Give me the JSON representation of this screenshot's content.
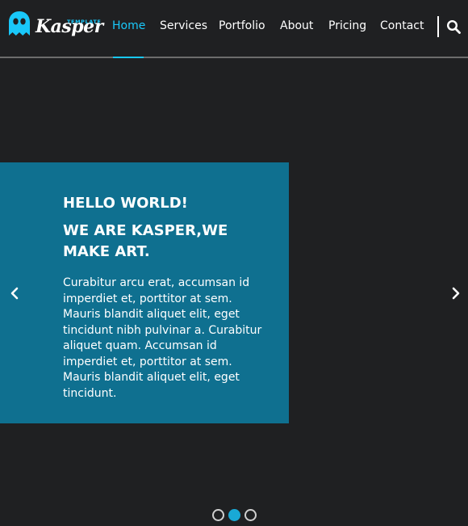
{
  "brand": {
    "name": "Kasper",
    "tag": "TEMPLATE",
    "accent_color": "#19c8fa"
  },
  "nav": {
    "items": [
      {
        "label": "Home",
        "active": true
      },
      {
        "label": "Services",
        "active": false
      },
      {
        "label": "Portfolio",
        "active": false
      },
      {
        "label": "About",
        "active": false
      },
      {
        "label": "Pricing",
        "active": false
      },
      {
        "label": "Contact",
        "active": false
      }
    ],
    "search_icon": "search-icon"
  },
  "slider": {
    "hello": "HELLO WORLD!",
    "heading": "WE ARE KASPER,WE MAKE ART.",
    "text": "Curabitur arcu erat, accumsan id imperdiet et, porttitor at sem. Mauris blandit aliquet elit, eget tincidunt nibh pulvinar a. Curabitur aliquet quam. Accumsan id imperdiet et, porttitor at sem. Mauris blandit aliquet elit, eget tincidunt.",
    "box_color": "#0f7090",
    "prev_icon": "chevron-left-icon",
    "next_icon": "chevron-right-icon",
    "slide_count": 3,
    "active_slide": 2
  }
}
